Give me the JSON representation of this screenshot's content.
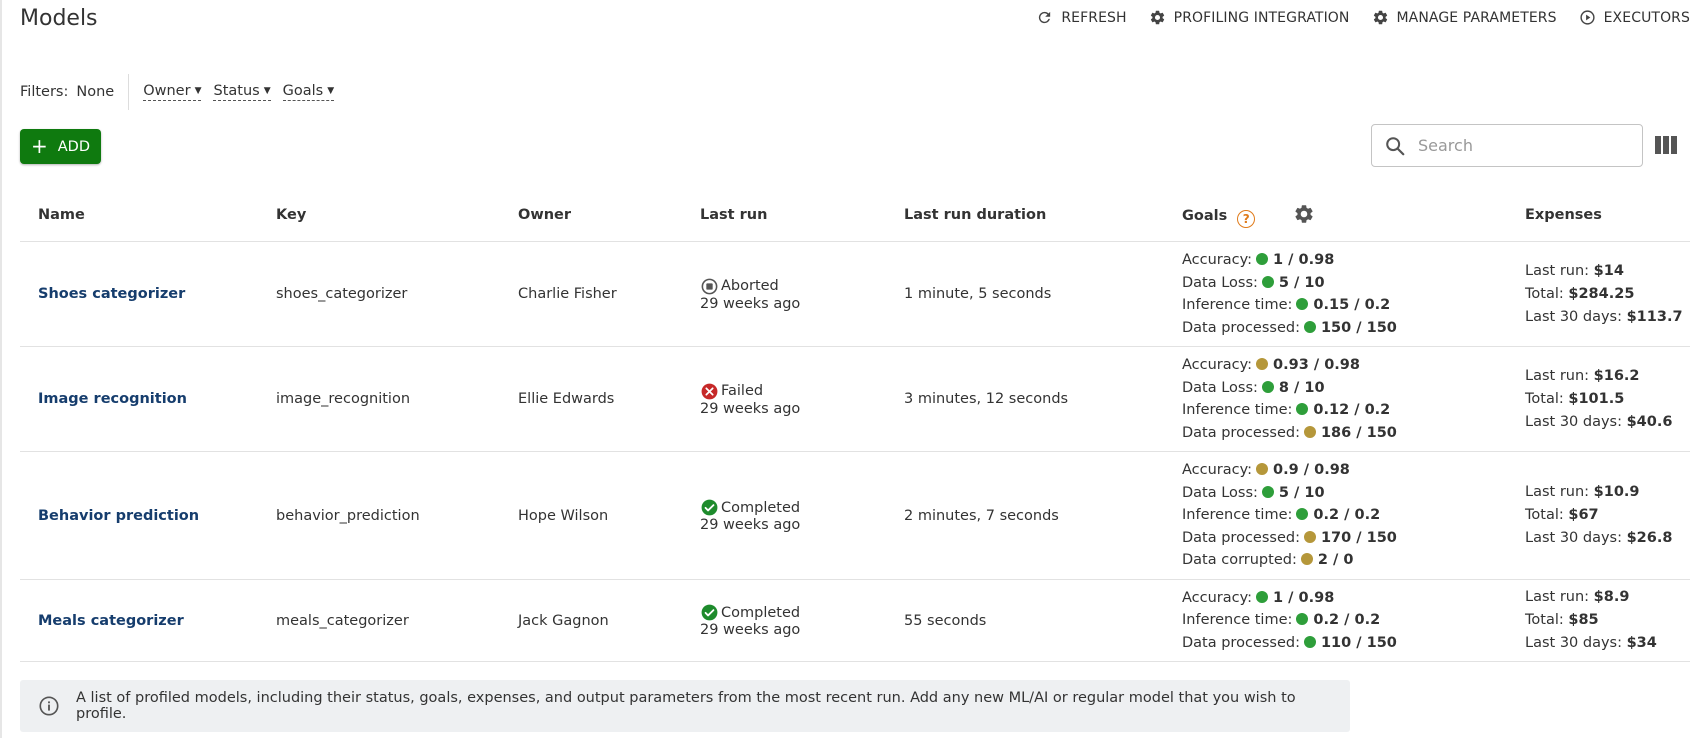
{
  "page": {
    "title": "Models"
  },
  "actions": [
    {
      "label": "REFRESH",
      "icon": "refresh-icon"
    },
    {
      "label": "PROFILING INTEGRATION",
      "icon": "gear-icon"
    },
    {
      "label": "MANAGE PARAMETERS",
      "icon": "gear-icon"
    },
    {
      "label": "EXECUTORS",
      "icon": "play-circle-icon"
    }
  ],
  "filters": {
    "label": "Filters:",
    "value": "None",
    "dropdowns": [
      "Owner",
      "Status",
      "Goals"
    ]
  },
  "add_button": {
    "label": "ADD"
  },
  "search": {
    "placeholder": "Search"
  },
  "table": {
    "headers": {
      "name": "Name",
      "key": "Key",
      "owner": "Owner",
      "last_run": "Last run",
      "duration": "Last run duration",
      "goals": "Goals",
      "expenses": "Expenses"
    },
    "rows": [
      {
        "name": "Shoes categorizer",
        "key": "shoes_categorizer",
        "owner": "Charlie Fisher",
        "status": "Aborted",
        "status_icon": "aborted-icon",
        "run_ago": "29 weeks ago",
        "duration": "1 minute, 5 seconds",
        "goals": [
          {
            "label": "Accuracy:",
            "value": "1 / 0.98",
            "color": "#2e9e3a"
          },
          {
            "label": "Data Loss:",
            "value": "5 / 10",
            "color": "#2e9e3a"
          },
          {
            "label": "Inference time:",
            "value": "0.15 / 0.2",
            "color": "#2e9e3a"
          },
          {
            "label": "Data processed:",
            "value": "150 / 150",
            "color": "#2e9e3a"
          }
        ],
        "expenses": {
          "last_run_label": "Last run:",
          "last_run": "$14",
          "total_label": "Total:",
          "total": "$284.25",
          "last30_label": "Last 30 days:",
          "last30": "$113.7"
        }
      },
      {
        "name": "Image recognition",
        "key": "image_recognition",
        "owner": "Ellie Edwards",
        "status": "Failed",
        "status_icon": "failed-icon",
        "run_ago": "29 weeks ago",
        "duration": "3 minutes, 12 seconds",
        "goals": [
          {
            "label": "Accuracy:",
            "value": "0.93 / 0.98",
            "color": "#b5973a"
          },
          {
            "label": "Data Loss:",
            "value": "8 / 10",
            "color": "#2e9e3a"
          },
          {
            "label": "Inference time:",
            "value": "0.12 / 0.2",
            "color": "#2e9e3a"
          },
          {
            "label": "Data processed:",
            "value": "186 / 150",
            "color": "#b5973a"
          }
        ],
        "expenses": {
          "last_run_label": "Last run:",
          "last_run": "$16.2",
          "total_label": "Total:",
          "total": "$101.5",
          "last30_label": "Last 30 days:",
          "last30": "$40.6"
        }
      },
      {
        "name": "Behavior prediction",
        "key": "behavior_prediction",
        "owner": "Hope Wilson",
        "status": "Completed",
        "status_icon": "completed-icon",
        "run_ago": "29 weeks ago",
        "duration": "2 minutes, 7 seconds",
        "goals": [
          {
            "label": "Accuracy:",
            "value": "0.9 / 0.98",
            "color": "#b5973a"
          },
          {
            "label": "Data Loss:",
            "value": "5 / 10",
            "color": "#2e9e3a"
          },
          {
            "label": "Inference time:",
            "value": "0.2 / 0.2",
            "color": "#2e9e3a"
          },
          {
            "label": "Data processed:",
            "value": "170 / 150",
            "color": "#b5973a"
          },
          {
            "label": "Data corrupted:",
            "value": "2 / 0",
            "color": "#b5973a"
          }
        ],
        "expenses": {
          "last_run_label": "Last run:",
          "last_run": "$10.9",
          "total_label": "Total:",
          "total": "$67",
          "last30_label": "Last 30 days:",
          "last30": "$26.8"
        }
      },
      {
        "name": "Meals categorizer",
        "key": "meals_categorizer",
        "owner": "Jack Gagnon",
        "status": "Completed",
        "status_icon": "completed-icon",
        "run_ago": "29 weeks ago",
        "duration": "55 seconds",
        "goals": [
          {
            "label": "Accuracy:",
            "value": "1 / 0.98",
            "color": "#2e9e3a"
          },
          {
            "label": "Inference time:",
            "value": "0.2 / 0.2",
            "color": "#2e9e3a"
          },
          {
            "label": "Data processed:",
            "value": "110 / 150",
            "color": "#2e9e3a"
          }
        ],
        "expenses": {
          "last_run_label": "Last run:",
          "last_run": "$8.9",
          "total_label": "Total:",
          "total": "$85",
          "last30_label": "Last 30 days:",
          "last30": "$34"
        }
      }
    ]
  },
  "info": {
    "text": "A list of profiled models, including their status, goals, expenses, and output parameters from the most recent run. Add any new ML/AI or regular model that you wish to profile."
  }
}
